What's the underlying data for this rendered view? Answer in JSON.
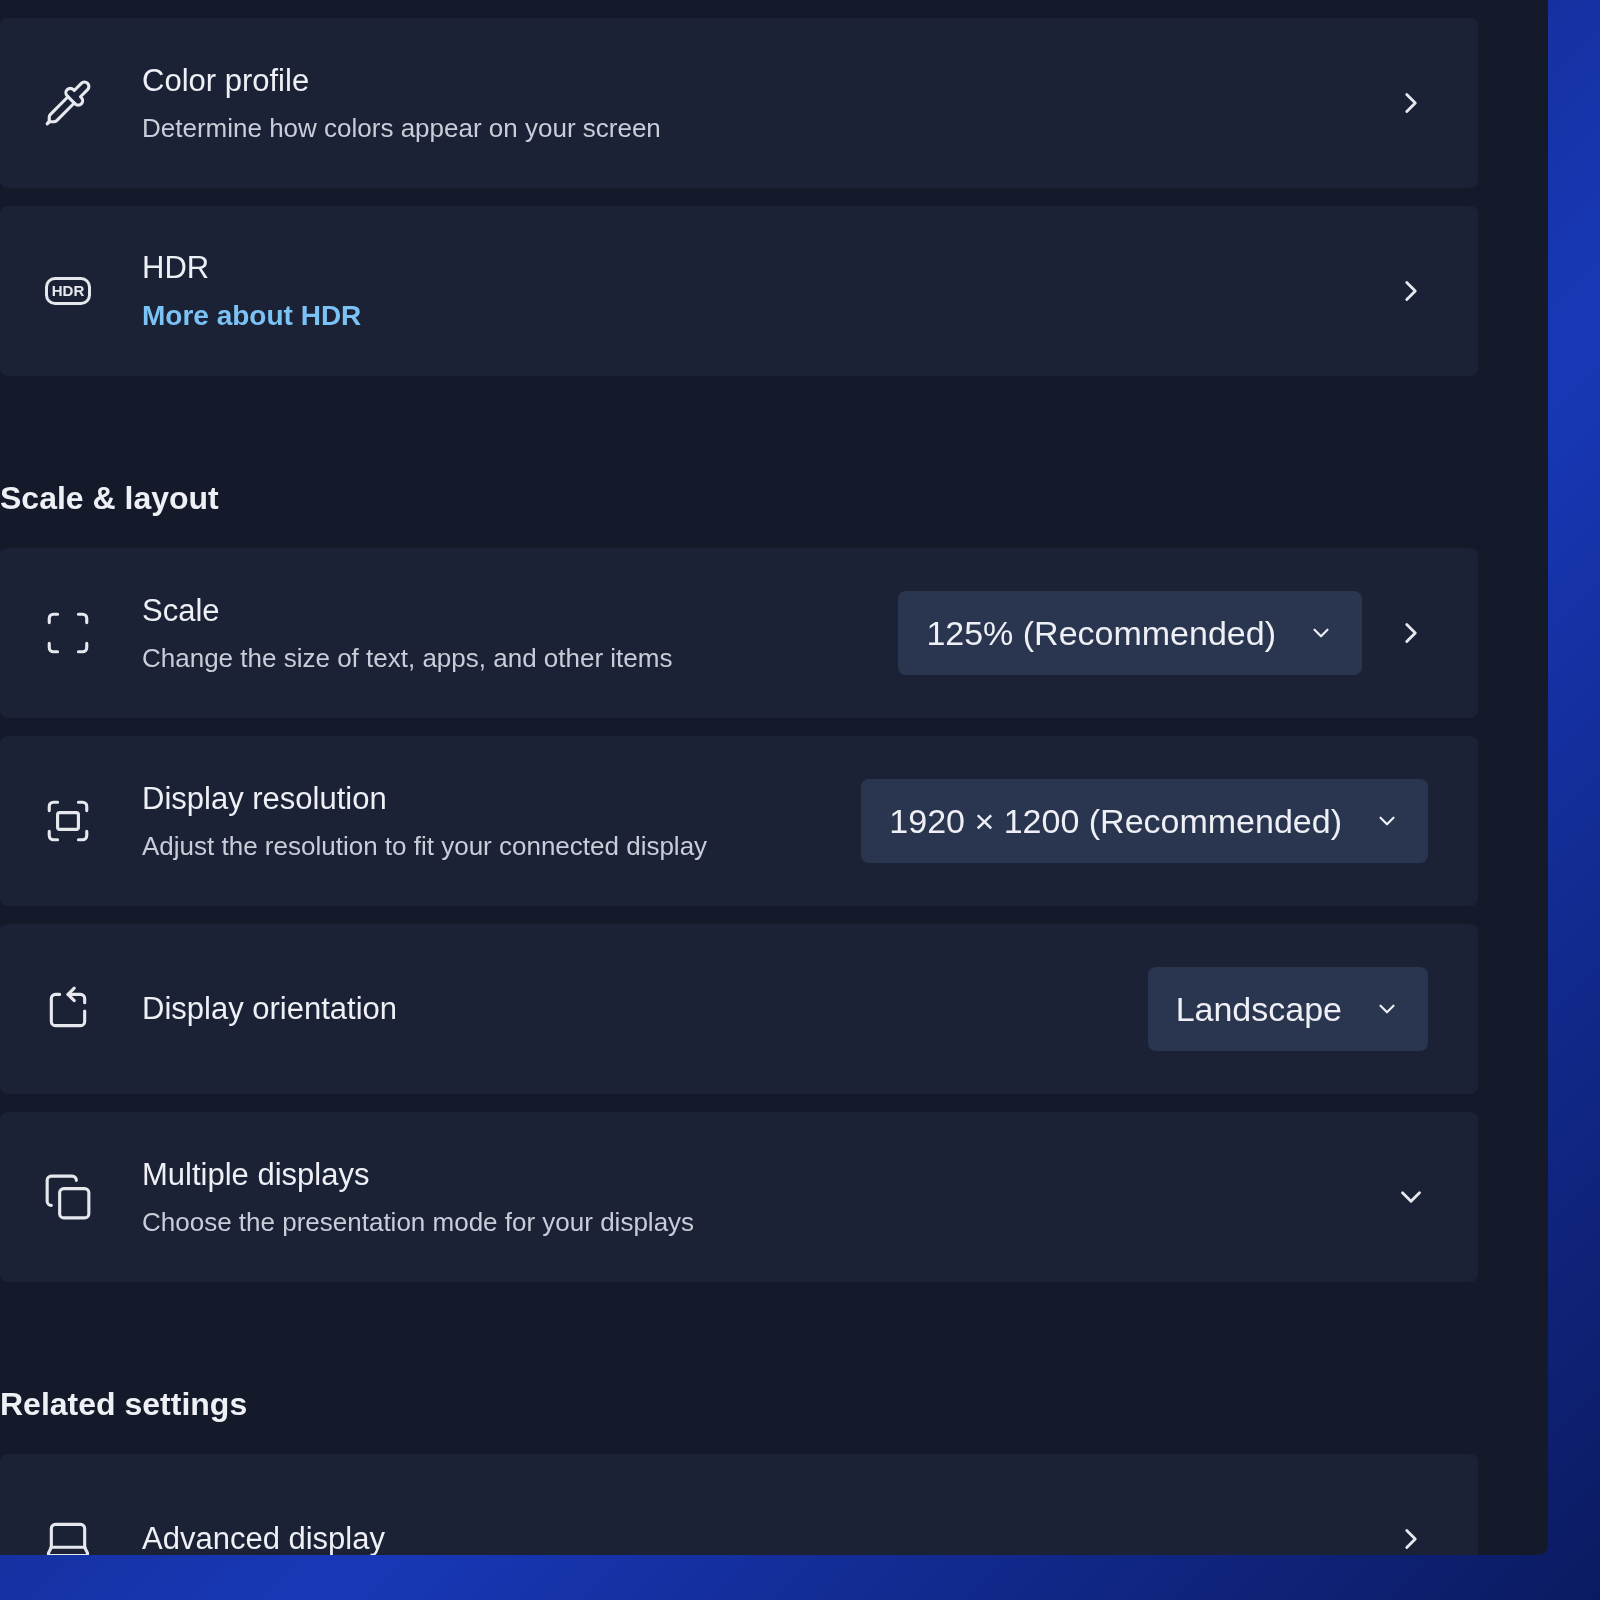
{
  "top_items": [
    {
      "kind": "link",
      "title": "Color profile",
      "description": "Determine how colors appear on your screen"
    },
    {
      "kind": "link",
      "icon_label": "HDR",
      "title": "HDR",
      "link": "More about HDR"
    }
  ],
  "sections": [
    {
      "heading": "Scale & layout",
      "items": [
        {
          "kind": "dropdown_link",
          "title": "Scale",
          "description": "Change the size of text, apps, and other items",
          "value": "125% (Recommended)"
        },
        {
          "kind": "dropdown",
          "title": "Display resolution",
          "description": "Adjust the resolution to fit your connected display",
          "value": "1920 × 1200 (Recommended)"
        },
        {
          "kind": "dropdown",
          "title": "Display orientation",
          "value": "Landscape"
        },
        {
          "kind": "expander",
          "title": "Multiple displays",
          "description": "Choose the presentation mode for your displays",
          "expanded": false
        }
      ]
    },
    {
      "heading": "Related settings",
      "items": [
        {
          "kind": "link",
          "title": "Advanced display"
        }
      ]
    }
  ]
}
